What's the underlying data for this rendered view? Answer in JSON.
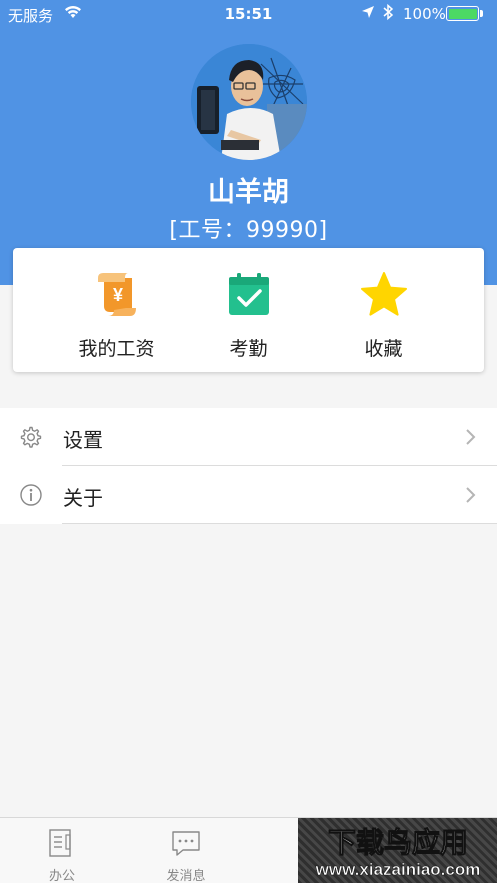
{
  "status_bar": {
    "carrier": "无服务",
    "time": "15:51",
    "battery_percent": "100%",
    "icons": [
      "wifi-icon",
      "location-arrow-icon",
      "bluetooth-icon",
      "battery-icon"
    ]
  },
  "profile": {
    "name": "山羊胡",
    "employee_id": "[工号：99990]"
  },
  "quick_actions": [
    {
      "label": "我的工资",
      "icon": "salary-scroll-icon",
      "color": "#f2972a"
    },
    {
      "label": "考勤",
      "icon": "calendar-check-icon",
      "color": "#23c08e"
    },
    {
      "label": "收藏",
      "icon": "star-icon",
      "color": "#ffd500"
    }
  ],
  "menu": [
    {
      "label": "设置",
      "icon": "gear-icon"
    },
    {
      "label": "关于",
      "icon": "info-icon"
    }
  ],
  "tabs": [
    {
      "label": "办公",
      "icon": "office-icon"
    },
    {
      "label": "发消息",
      "icon": "message-icon"
    }
  ],
  "watermark_text": "下载鸟应用",
  "watermark_url": "www.xiazainiao.com",
  "colors": {
    "header_blue": "#5093e4",
    "tab_text": "#888888"
  }
}
